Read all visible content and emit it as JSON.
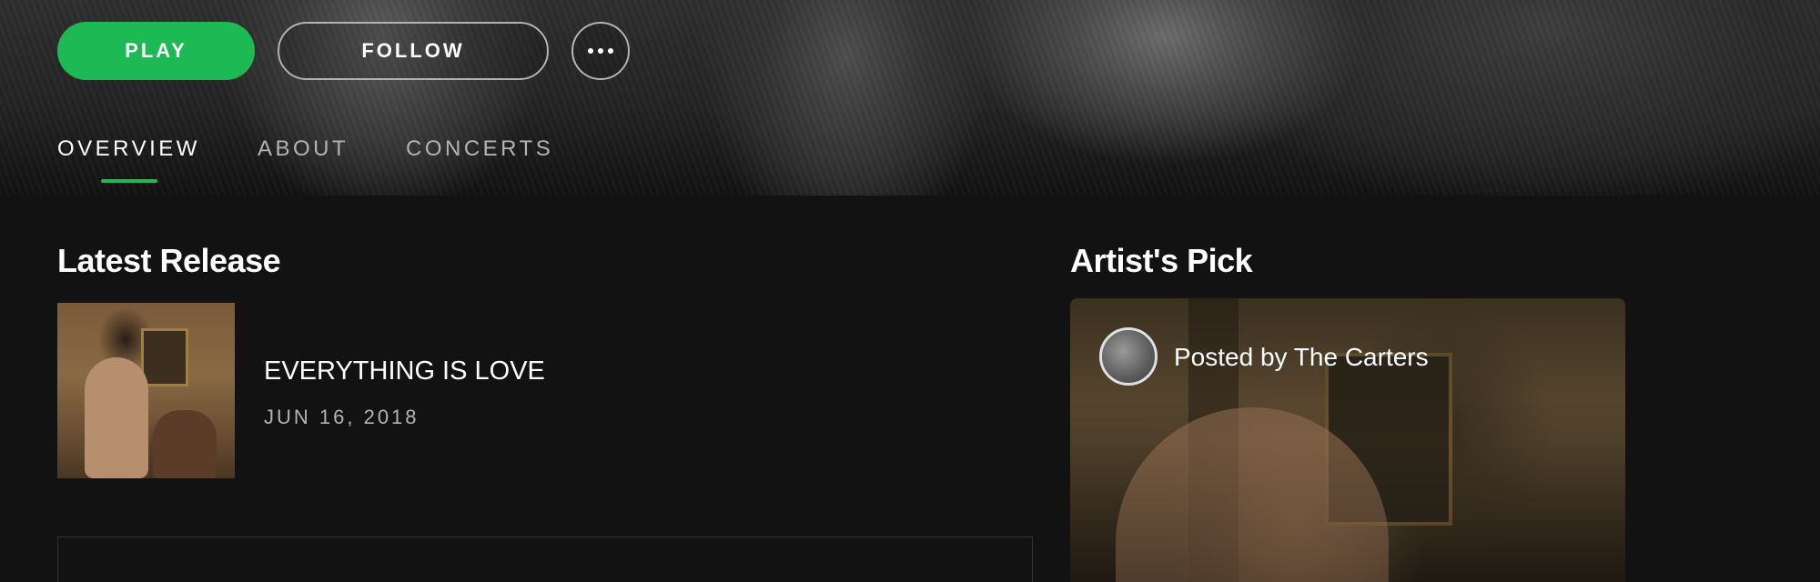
{
  "header": {
    "play_label": "PLAY",
    "follow_label": "FOLLOW",
    "more_icon": "more-dots-icon"
  },
  "tabs": [
    {
      "label": "OVERVIEW",
      "active": true
    },
    {
      "label": "ABOUT",
      "active": false
    },
    {
      "label": "CONCERTS",
      "active": false
    }
  ],
  "latest_release": {
    "section_title": "Latest Release",
    "album_title": "EVERYTHING IS LOVE",
    "release_date": "JUN 16, 2018"
  },
  "artist_pick": {
    "section_title": "Artist's Pick",
    "posted_by": "Posted by The Carters"
  },
  "colors": {
    "accent": "#1db954",
    "background": "#121212",
    "muted_text": "#b3b3b3"
  }
}
